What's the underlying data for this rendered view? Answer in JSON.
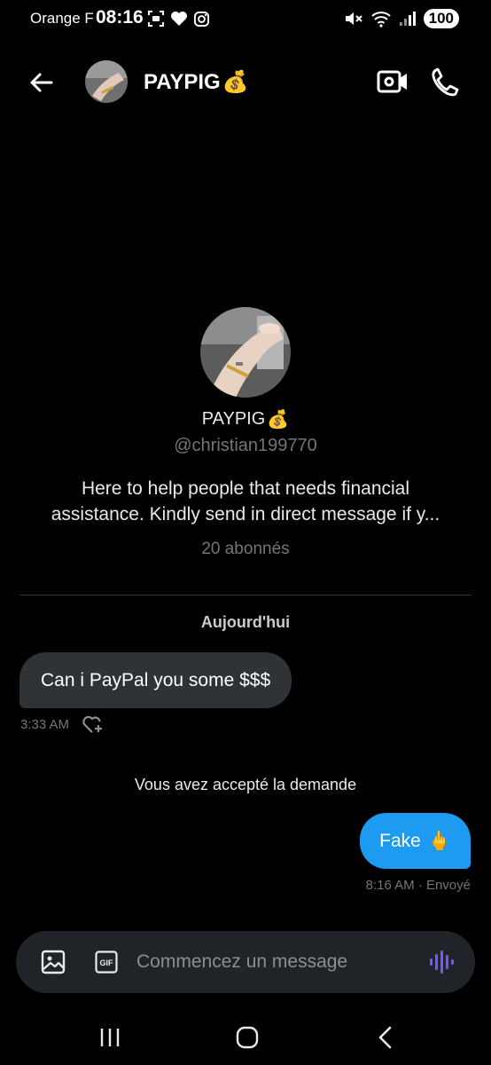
{
  "status_bar": {
    "carrier": "Orange F",
    "time": "08:16",
    "battery": "100",
    "icons_left": [
      "screenshot-icon",
      "heart-icon",
      "instagram-icon"
    ],
    "icons_right": [
      "mute-icon",
      "wifi-icon",
      "signal-icon",
      "battery-icon"
    ]
  },
  "header": {
    "name": "PAYPIG",
    "name_emoji": "💰",
    "icons": [
      "back-arrow-icon",
      "video-call-icon",
      "phone-icon"
    ]
  },
  "profile": {
    "name": "PAYPIG",
    "name_emoji": "💰",
    "handle": "@christian199770",
    "bio": "Here to help people that needs financial assistance. Kindly send in direct message if y...",
    "followers": "20 abonnés"
  },
  "conversation": {
    "day_label": "Aujourd'hui",
    "incoming": {
      "text": "Can i PayPal you some $$$",
      "time": "3:33 AM"
    },
    "system_message": "Vous avez accepté la demande",
    "outgoing": {
      "text": "Fake",
      "emoji": "🖕",
      "meta": "8:16 AM · Envoyé"
    }
  },
  "composer": {
    "placeholder": "Commencez un message",
    "gif_label": "GIF",
    "icons": [
      "image-icon",
      "gif-icon",
      "voice-message-icon"
    ]
  },
  "colors": {
    "background": "#000000",
    "bubble_incoming": "#2f3336",
    "bubble_outgoing": "#1d9bf0",
    "muted_text": "#71767b",
    "voice_accent": "#7856ff"
  }
}
